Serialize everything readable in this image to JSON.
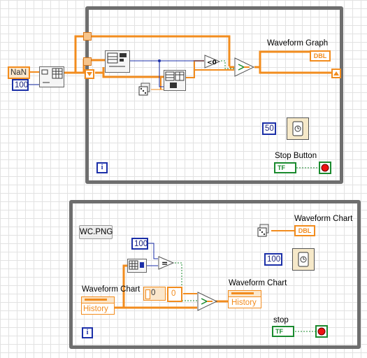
{
  "top_diagram": {
    "nan_constant": "NaN",
    "length_constant": "100",
    "waveform_graph_label": "Waveform Graph",
    "waveform_graph_terminal": "DBL",
    "wait_ms_constant": "50",
    "stop_button_label": "Stop Button",
    "stop_terminal": "TF",
    "iteration_terminal": "i",
    "compare_symbol": "<0"
  },
  "bottom_diagram": {
    "wc_png_label": "WC.PNG",
    "waveform_chart_label_right": "Waveform Chart",
    "dbl_terminal": "DBL",
    "wait_ms_constant": "100",
    "compare_constant": "100",
    "compare_symbol": "=",
    "history_node_label": "Waveform Chart",
    "history_node_property": "History",
    "array_index_0": "0",
    "array_index_0b": "0",
    "history_write_label": "Waveform Chart",
    "history_write_property": "History",
    "stop_label": "stop",
    "stop_terminal": "TF",
    "iteration_terminal": "i"
  },
  "colors": {
    "loop_border": "#6e6e6e",
    "orange_wire": "#f28c1e",
    "blue_wire": "#1b2fa8",
    "green_wire": "#1a8a2e",
    "grid": "#e2e2e2"
  }
}
